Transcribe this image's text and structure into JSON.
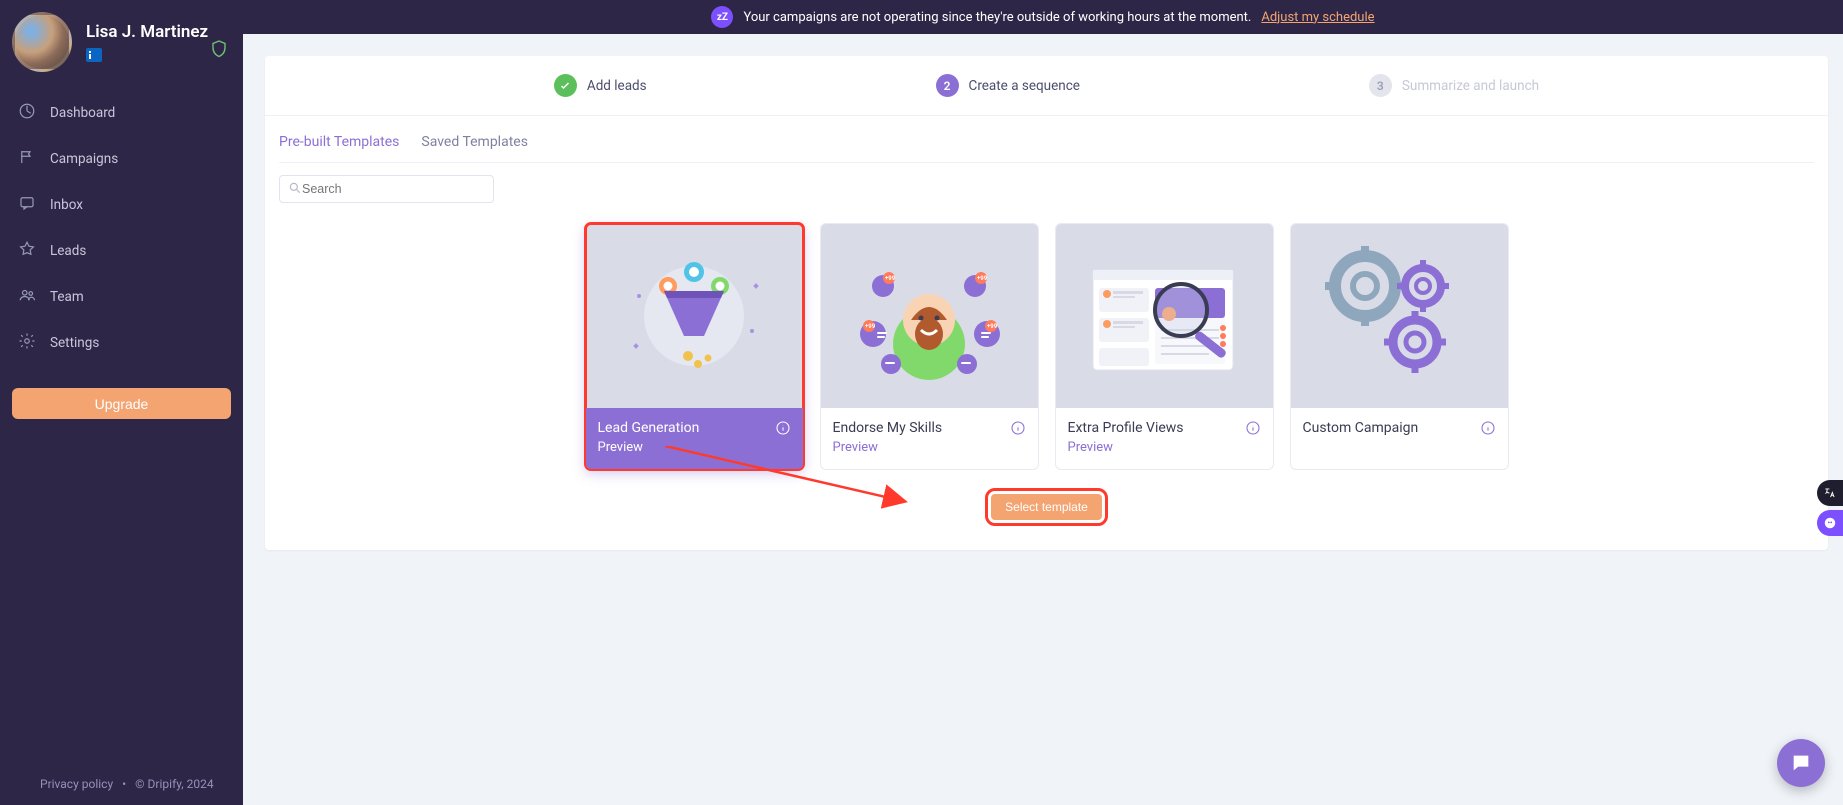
{
  "profile": {
    "name": "Lisa J. Martinez"
  },
  "sidebar": {
    "items": [
      {
        "label": "Dashboard"
      },
      {
        "label": "Campaigns"
      },
      {
        "label": "Inbox"
      },
      {
        "label": "Leads"
      },
      {
        "label": "Team"
      },
      {
        "label": "Settings"
      }
    ],
    "upgrade_label": "Upgrade"
  },
  "footer": {
    "privacy": "Privacy policy",
    "dot": "•",
    "copyright": "© Dripify, 2024"
  },
  "banner": {
    "message": "Your campaigns are not operating since they're outside of working hours at the moment.",
    "link": "Adjust my schedule"
  },
  "stepper": [
    {
      "status": "done",
      "label": "Add leads",
      "number": ""
    },
    {
      "status": "active",
      "label": "Create a sequence",
      "number": "2"
    },
    {
      "status": "inactive",
      "label": "Summarize and launch",
      "number": "3"
    }
  ],
  "tabs": [
    {
      "label": "Pre-built Templates",
      "active": true
    },
    {
      "label": "Saved Templates",
      "active": false
    }
  ],
  "search": {
    "placeholder": "Search"
  },
  "templates": [
    {
      "title": "Lead Generation",
      "preview": "Preview",
      "selected": true
    },
    {
      "title": "Endorse My Skills",
      "preview": "Preview",
      "selected": false
    },
    {
      "title": "Extra Profile Views",
      "preview": "Preview",
      "selected": false
    },
    {
      "title": "Custom Campaign",
      "preview": "",
      "selected": false
    }
  ],
  "select_button": {
    "label": "Select template"
  }
}
